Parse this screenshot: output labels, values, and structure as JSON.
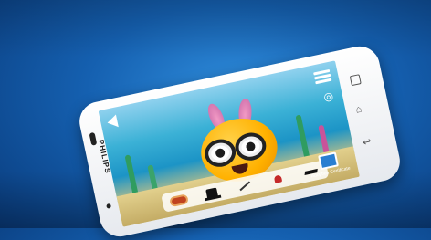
{
  "device": {
    "brand": "PHILIPS"
  },
  "app": {
    "certificate_label": "Adoption Certificate",
    "accessories": [
      {
        "name": "hotdog-icon"
      },
      {
        "name": "top-hat-icon"
      },
      {
        "name": "magic-wand-icon"
      },
      {
        "name": "plunger-icon"
      },
      {
        "name": "graduation-cap-icon"
      }
    ]
  },
  "colors": {
    "background": "#1560b0",
    "phone_body": "#ffffff",
    "creature": "#ffb100"
  }
}
